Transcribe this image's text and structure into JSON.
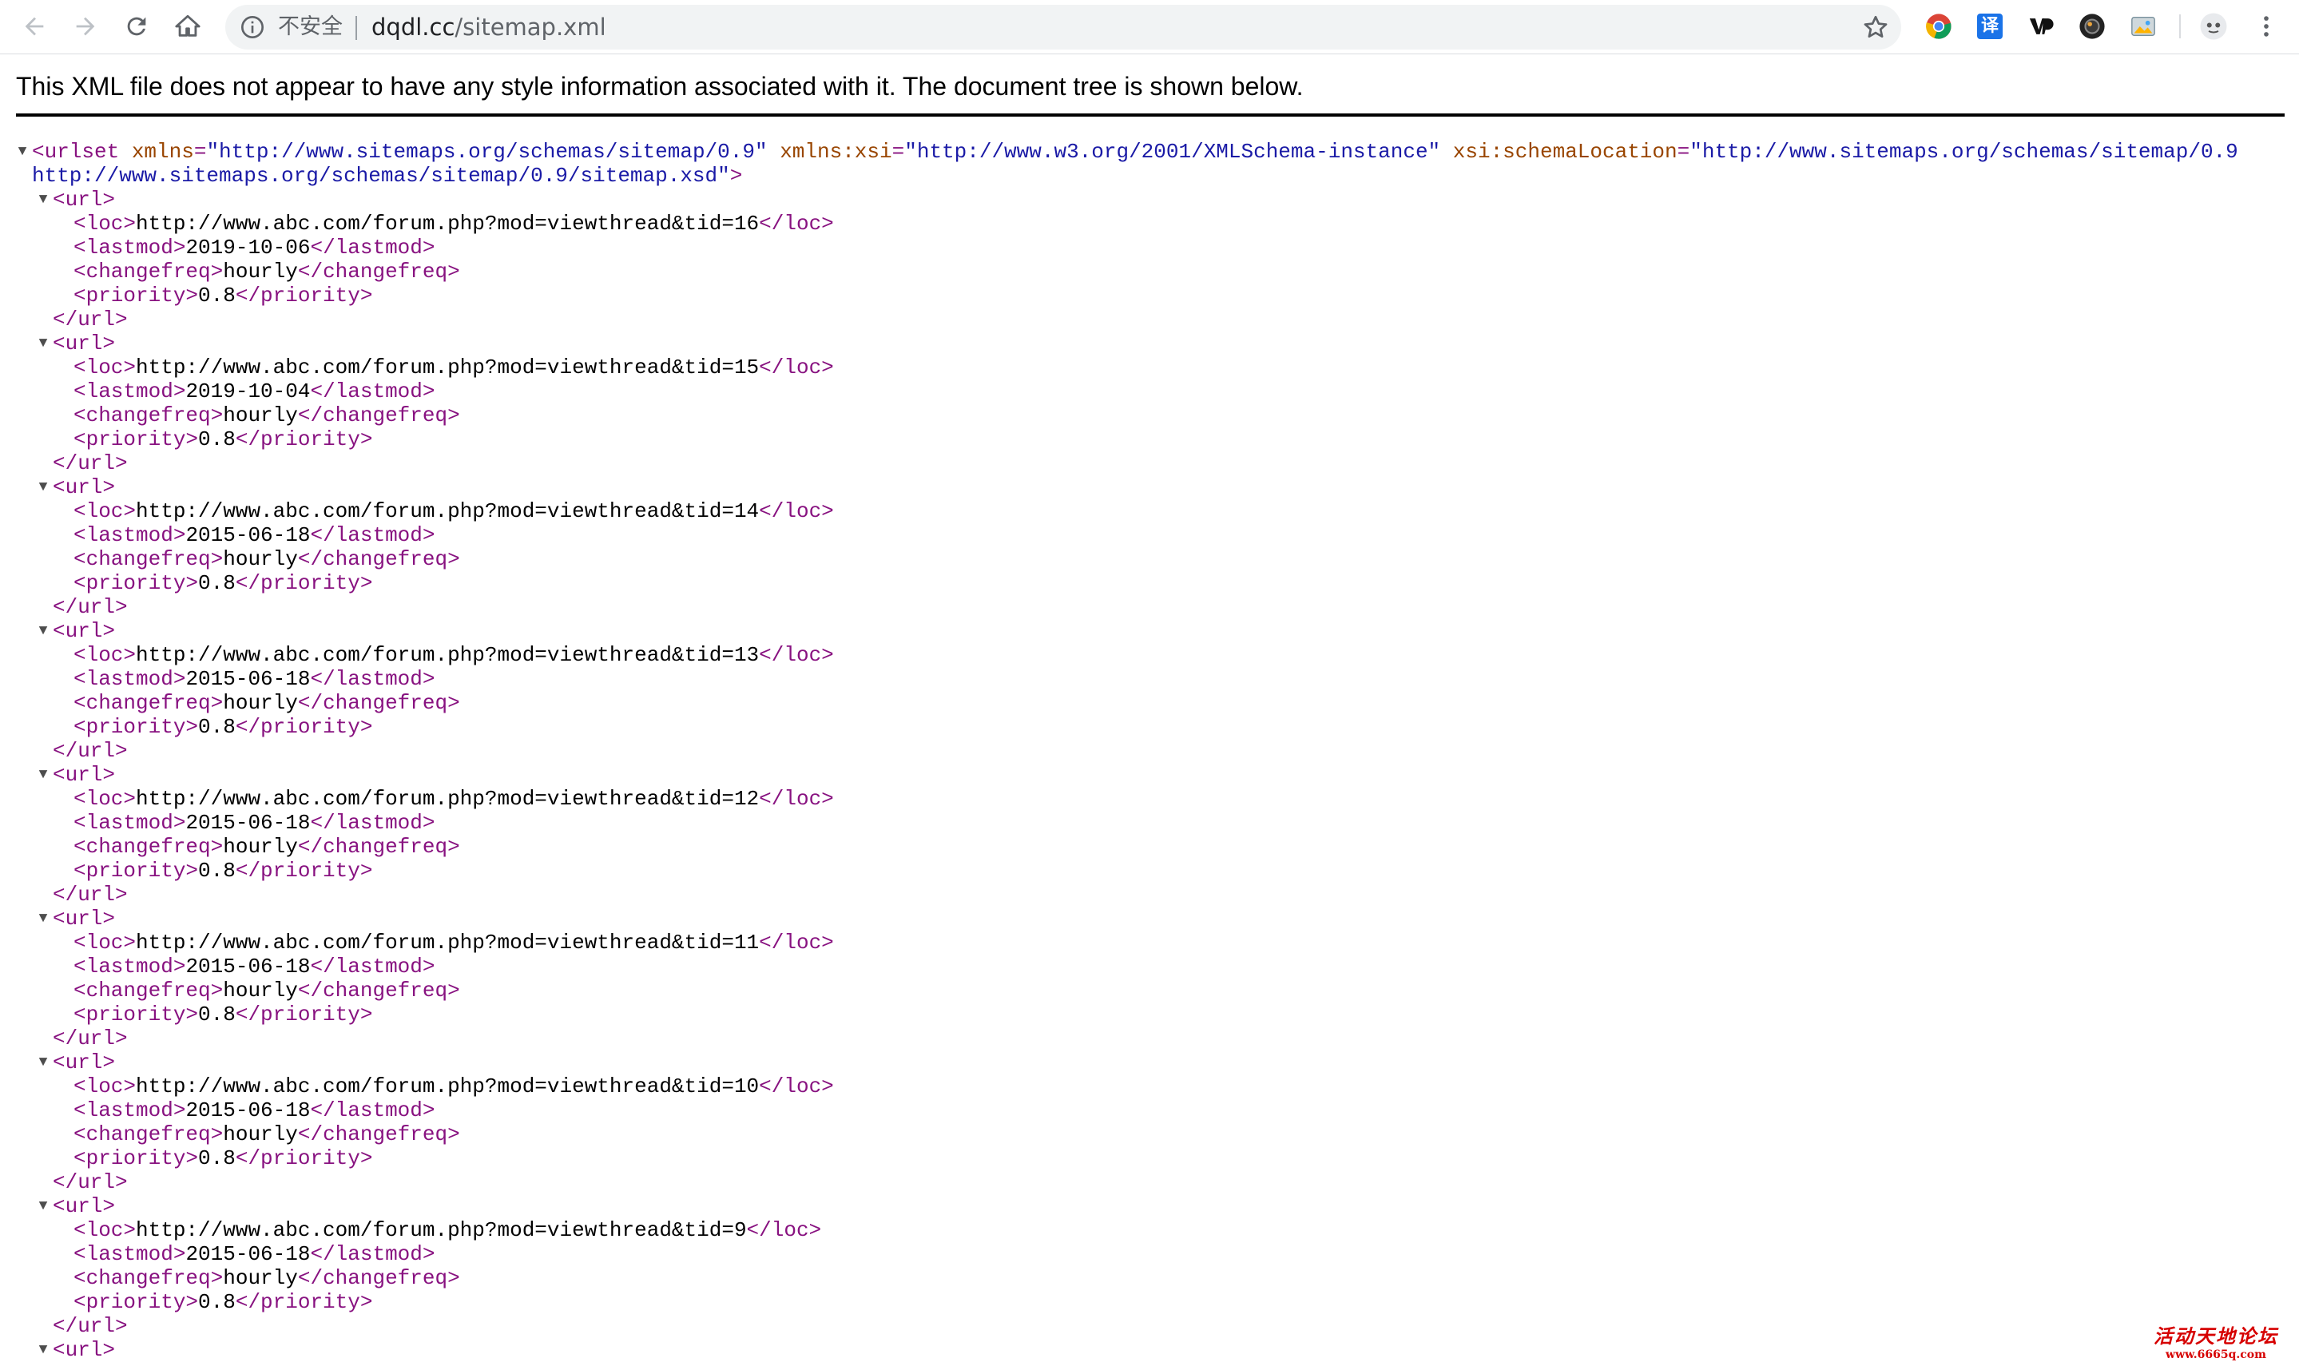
{
  "browser": {
    "security_label": "不安全",
    "url_host": "dqdl.cc",
    "url_path": "/sitemap.xml",
    "extensions": [
      "chrome-icon",
      "translate-icon",
      "vimeo-icon",
      "camera-icon",
      "image-icon",
      "account-icon"
    ],
    "translate_glyph": "译"
  },
  "viewer": {
    "info_text": "This XML file does not appear to have any style information associated with it. The document tree is shown below."
  },
  "xml": {
    "root_open": "<urlset",
    "attr1_name": "xmlns",
    "attr1_value": "\"http://www.sitemaps.org/schemas/sitemap/0.9\"",
    "attr2_name": "xmlns:xsi",
    "attr2_value": "\"http://www.w3.org/2001/XMLSchema-instance\"",
    "attr3_name": "xsi:schemaLocation",
    "attr3_value_line1": "\"http://www.sitemaps.org/schemas/sitemap/0.9",
    "attr3_value_line2": "http://www.sitemaps.org/schemas/sitemap/0.9/sitemap.xsd\"",
    "root_close_bracket": ">",
    "tag_url_open": "<url>",
    "tag_url_close": "</url>",
    "tag_loc_open": "<loc>",
    "tag_loc_close": "</loc>",
    "tag_lastmod_open": "<lastmod>",
    "tag_lastmod_close": "</lastmod>",
    "tag_changefreq_open": "<changefreq>",
    "tag_changefreq_close": "</changefreq>",
    "tag_priority_open": "<priority>",
    "tag_priority_close": "</priority>",
    "fold_glyph": "▼",
    "urls": [
      {
        "loc": "http://www.abc.com/forum.php?mod=viewthread&tid=16",
        "lastmod": "2019-10-06",
        "changefreq": "hourly",
        "priority": "0.8"
      },
      {
        "loc": "http://www.abc.com/forum.php?mod=viewthread&tid=15",
        "lastmod": "2019-10-04",
        "changefreq": "hourly",
        "priority": "0.8"
      },
      {
        "loc": "http://www.abc.com/forum.php?mod=viewthread&tid=14",
        "lastmod": "2015-06-18",
        "changefreq": "hourly",
        "priority": "0.8"
      },
      {
        "loc": "http://www.abc.com/forum.php?mod=viewthread&tid=13",
        "lastmod": "2015-06-18",
        "changefreq": "hourly",
        "priority": "0.8"
      },
      {
        "loc": "http://www.abc.com/forum.php?mod=viewthread&tid=12",
        "lastmod": "2015-06-18",
        "changefreq": "hourly",
        "priority": "0.8"
      },
      {
        "loc": "http://www.abc.com/forum.php?mod=viewthread&tid=11",
        "lastmod": "2015-06-18",
        "changefreq": "hourly",
        "priority": "0.8"
      },
      {
        "loc": "http://www.abc.com/forum.php?mod=viewthread&tid=10",
        "lastmod": "2015-06-18",
        "changefreq": "hourly",
        "priority": "0.8"
      },
      {
        "loc": "http://www.abc.com/forum.php?mod=viewthread&tid=9",
        "lastmod": "2015-06-18",
        "changefreq": "hourly",
        "priority": "0.8"
      }
    ]
  },
  "watermark": {
    "line1": "活动天地论坛",
    "line2": "www.6665q.com"
  }
}
